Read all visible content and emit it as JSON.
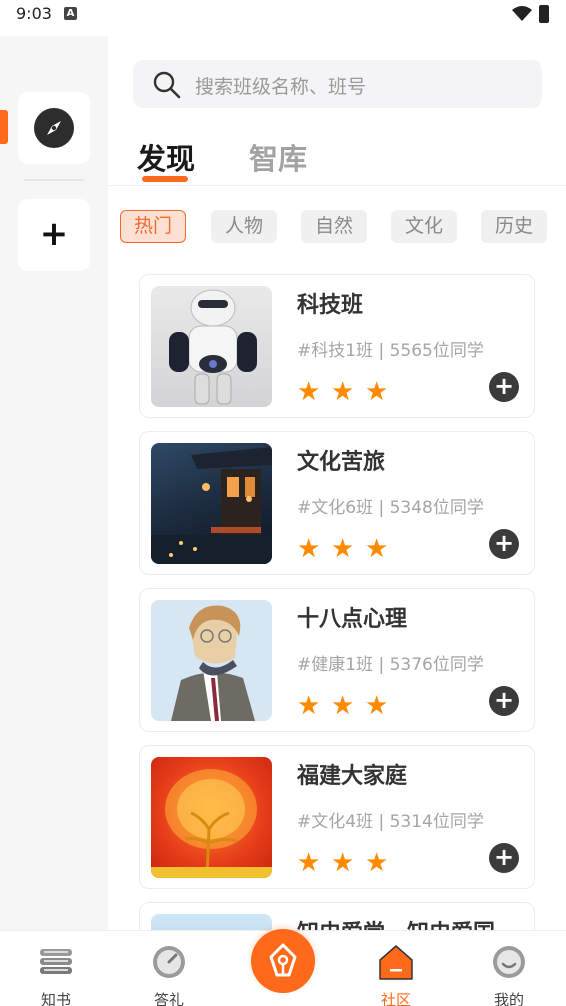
{
  "status_bar": {
    "time": "9:03",
    "notification_icon": "A"
  },
  "sidebar": {
    "items": [
      {
        "icon": "compass-icon"
      },
      {
        "icon": "plus-icon",
        "label": "+"
      }
    ]
  },
  "search": {
    "placeholder": "搜索班级名称、班号"
  },
  "tabs": [
    {
      "label": "发现",
      "active": true
    },
    {
      "label": "智库",
      "active": false
    }
  ],
  "categories": [
    {
      "label": "热门",
      "active": true
    },
    {
      "label": "人物",
      "active": false
    },
    {
      "label": "自然",
      "active": false
    },
    {
      "label": "文化",
      "active": false
    },
    {
      "label": "历史",
      "active": false
    }
  ],
  "classes": [
    {
      "title": "科技班",
      "meta": "#科技1班 | 5565位同学",
      "stars": 3
    },
    {
      "title": "文化苦旅",
      "meta": "#文化6班 | 5348位同学",
      "stars": 3
    },
    {
      "title": "十八点心理",
      "meta": "#健康1班 | 5376位同学",
      "stars": 3
    },
    {
      "title": "福建大家庭",
      "meta": "#文化4班 | 5314位同学",
      "stars": 3
    }
  ],
  "partial_card_title": "知史爱党，知史爱国",
  "bottom_nav": [
    {
      "label": "知书",
      "icon": "books-icon"
    },
    {
      "label": "答礼",
      "icon": "gauge-icon"
    },
    {
      "label": "",
      "icon": "pen-icon"
    },
    {
      "label": "社区",
      "icon": "house-icon",
      "active": true
    },
    {
      "label": "我的",
      "icon": "smile-icon"
    }
  ],
  "colors": {
    "accent": "#ff6a1a",
    "star": "#ff8a00"
  }
}
